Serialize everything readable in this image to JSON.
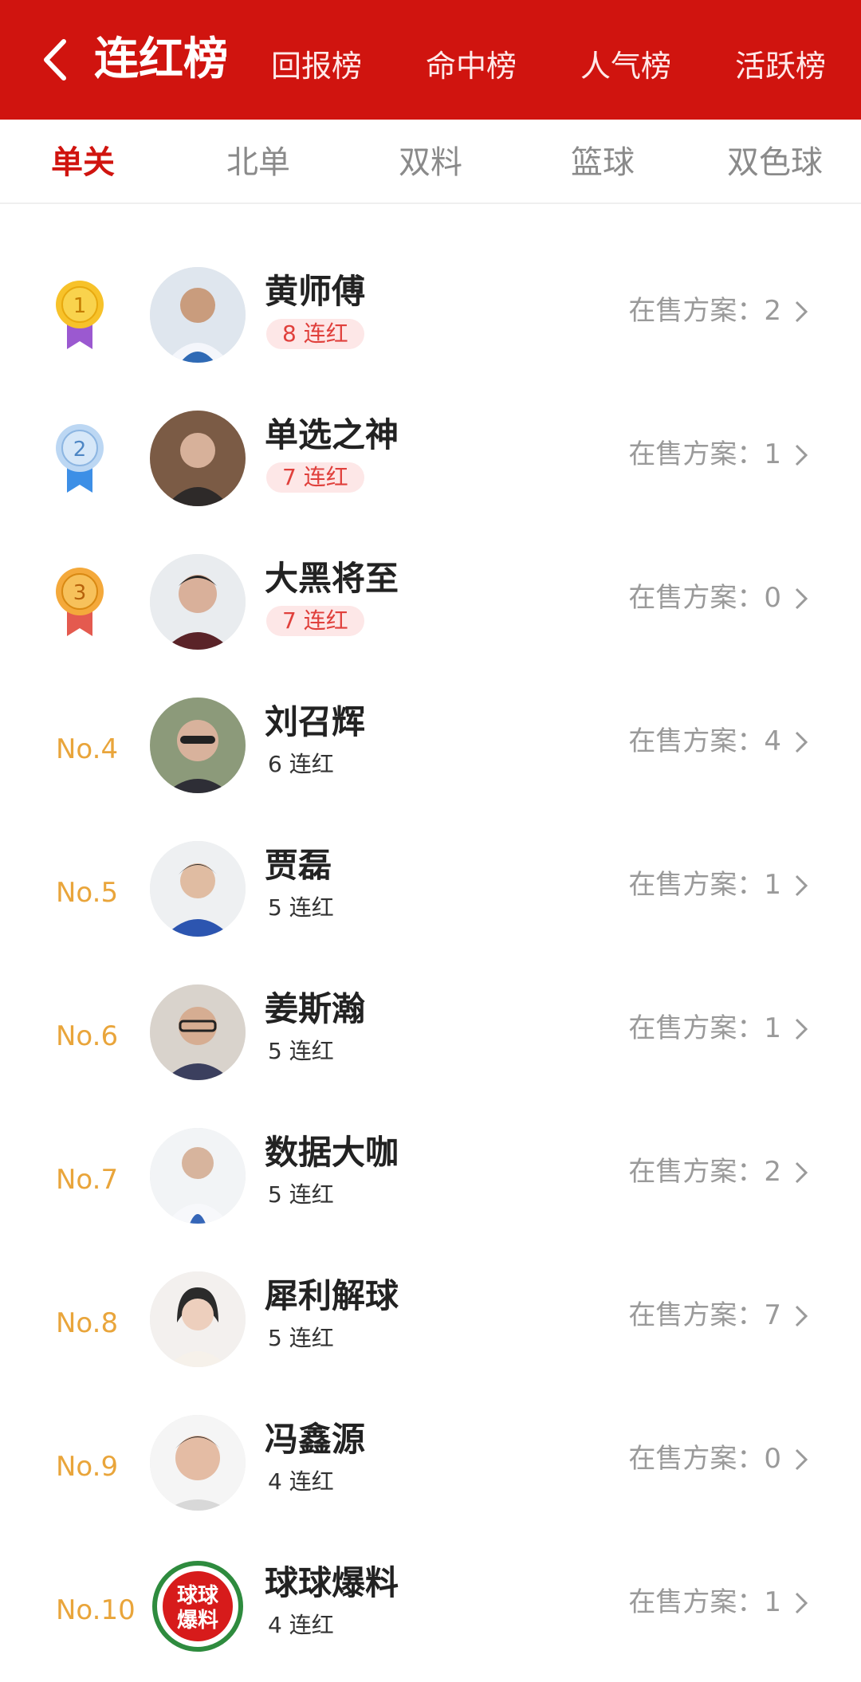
{
  "header": {
    "title": "连红榜",
    "tabs": [
      "回报榜",
      "命中榜",
      "人气榜",
      "活跃榜"
    ]
  },
  "subtabs": {
    "items": [
      "单关",
      "北单",
      "双料",
      "篮球",
      "双色球"
    ],
    "active_index": 0
  },
  "colors": {
    "brand": "#d0140f",
    "gold": "#e9a53b",
    "badge_bg": "#fde7e7",
    "badge_text": "#e0403c"
  },
  "rows": [
    {
      "rank_icon": "gold-medal-icon",
      "rank_number": "1",
      "name": "黄师傅",
      "streak": "8 连红",
      "sale": "在售方案：2"
    },
    {
      "rank_icon": "silver-medal-icon",
      "rank_number": "2",
      "name": "单选之神",
      "streak": "7 连红",
      "sale": "在售方案：1"
    },
    {
      "rank_icon": "bronze-medal-icon",
      "rank_number": "3",
      "name": "大黑将至",
      "streak": "7 连红",
      "sale": "在售方案：0"
    },
    {
      "rank": "No.4",
      "name": "刘召辉",
      "streak": "6 连红",
      "sale": "在售方案：4"
    },
    {
      "rank": "No.5",
      "name": "贾磊",
      "streak": "5 连红",
      "sale": "在售方案：1"
    },
    {
      "rank": "No.6",
      "name": "姜斯瀚",
      "streak": "5 连红",
      "sale": "在售方案：1"
    },
    {
      "rank": "No.7",
      "name": "数据大咖",
      "streak": "5 连红",
      "sale": "在售方案：2"
    },
    {
      "rank": "No.8",
      "name": "犀利解球",
      "streak": "5 连红",
      "sale": "在售方案：7"
    },
    {
      "rank": "No.9",
      "name": "冯鑫源",
      "streak": "4 连红",
      "sale": "在售方案：0"
    },
    {
      "rank": "No.10",
      "name": "球球爆料",
      "streak": "4 连红",
      "sale": "在售方案：1",
      "avatar_logo_text": "球球爆料"
    }
  ]
}
